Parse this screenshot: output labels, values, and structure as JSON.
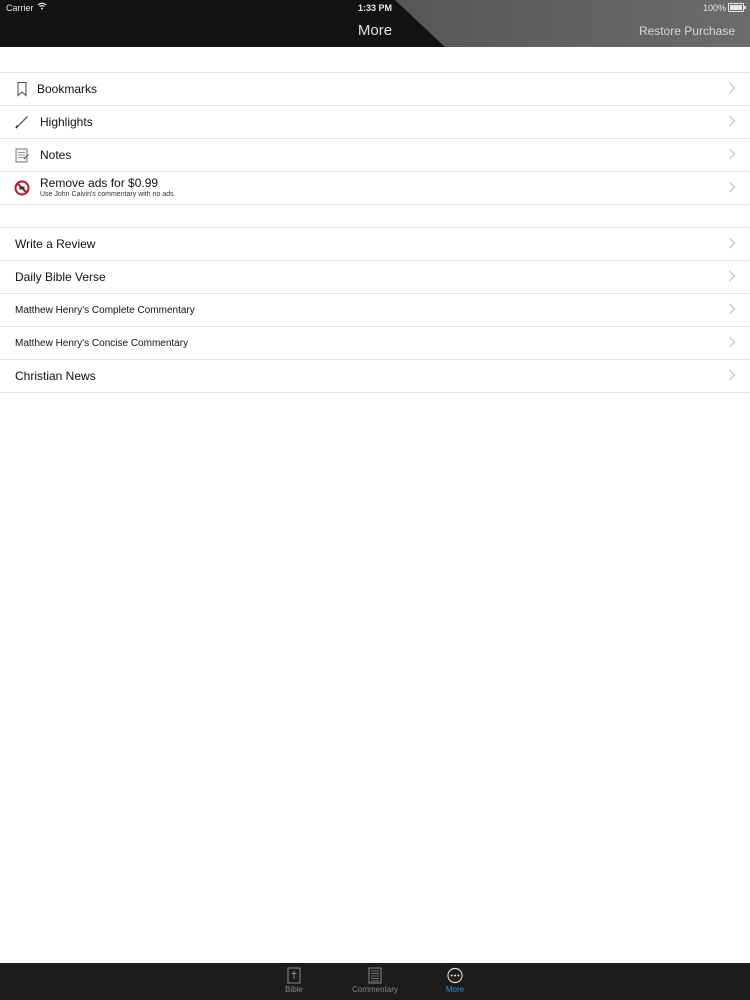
{
  "status_bar": {
    "carrier": "Carrier",
    "time": "1:33 PM",
    "battery": "100%"
  },
  "nav": {
    "title": "More",
    "restore_label": "Restore Purchase"
  },
  "group1": [
    {
      "label": "Bookmarks",
      "icon": "bookmark-icon"
    },
    {
      "label": "Highlights",
      "icon": "pencil-icon"
    },
    {
      "label": "Notes",
      "icon": "notepad-icon"
    },
    {
      "label": "Remove ads for $0.99",
      "sublabel": "Use John Calvin's commentary with no ads",
      "icon": "no-ads-icon"
    }
  ],
  "group2": [
    {
      "label": "Write a Review"
    },
    {
      "label": "Daily Bible Verse"
    },
    {
      "label": "Matthew Henry's Complete Commentary"
    },
    {
      "label": "Matthew Henry's Concise Commentary"
    },
    {
      "label": "Christian News"
    }
  ],
  "tabs": [
    {
      "label": "Bible",
      "icon": "bible-icon"
    },
    {
      "label": "Commentary",
      "icon": "commentary-icon"
    },
    {
      "label": "More",
      "icon": "more-icon",
      "active": true
    }
  ],
  "colors": {
    "accent": "#2f8fe0",
    "nav_bg": "#121212",
    "tabbar_bg": "#1c1c1c",
    "no_ads_red": "#c8102e"
  }
}
